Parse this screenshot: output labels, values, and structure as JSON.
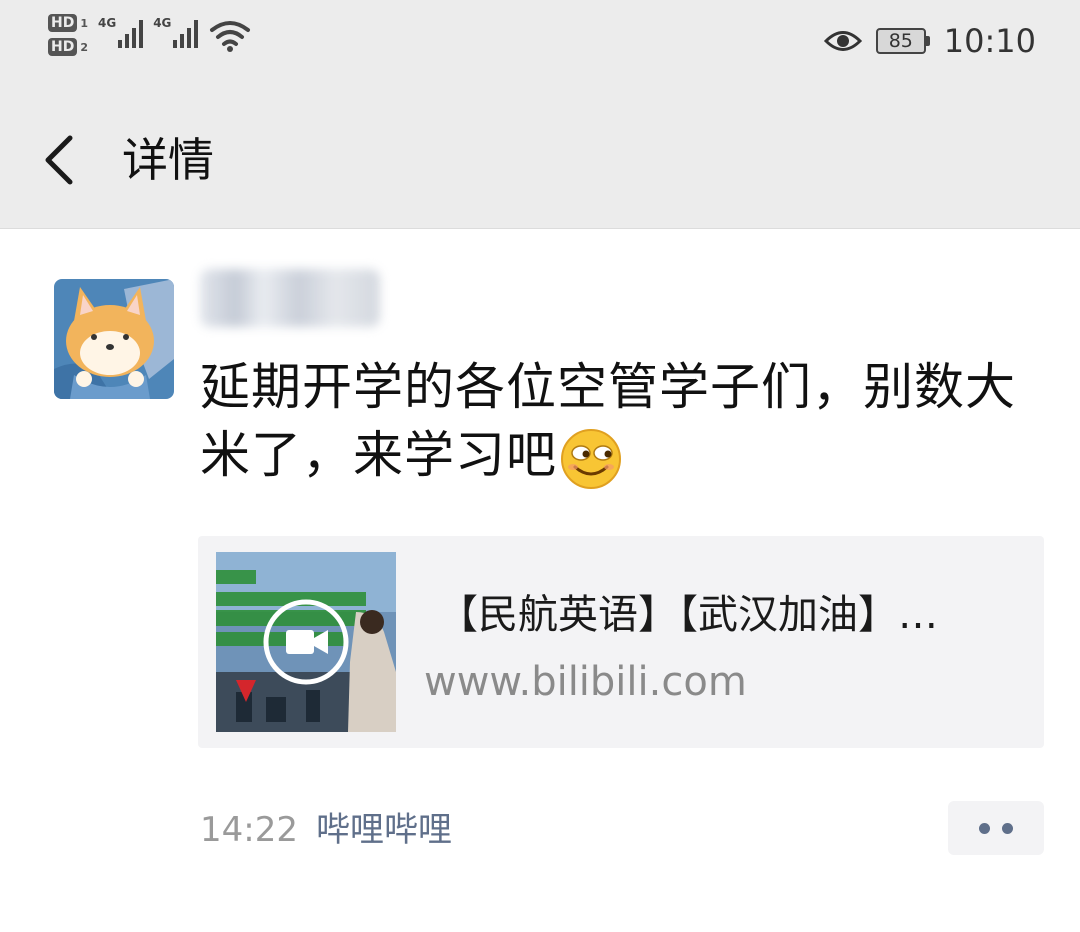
{
  "status_bar": {
    "hd1": "HD",
    "hd1_sub": "1",
    "hd2": "HD",
    "hd2_sub": "2",
    "net1": "4G",
    "net2": "4G",
    "battery": "85",
    "time": "10:10",
    "icons": [
      "eye-icon",
      "wifi-icon",
      "signal-icon",
      "battery-icon"
    ]
  },
  "header": {
    "title": "详情",
    "back_icon": "chevron-left-icon"
  },
  "post": {
    "message": "延期开学的各位空管学子们，别数大米了，来学习吧",
    "emoji": "smirk-face-emoji",
    "link": {
      "title": "【民航英语】【武汉加油】…",
      "domain": "www.bilibili.com",
      "thumbnail_icon": "video-play-icon"
    },
    "time": "14:22",
    "source": "哔哩哔哩",
    "more_icon": "more-dots-icon"
  },
  "colors": {
    "header_bg": "#ececec",
    "link_card_bg": "#f3f3f5",
    "source_link": "#5f6f8a",
    "time_gray": "#9a9a9a"
  }
}
